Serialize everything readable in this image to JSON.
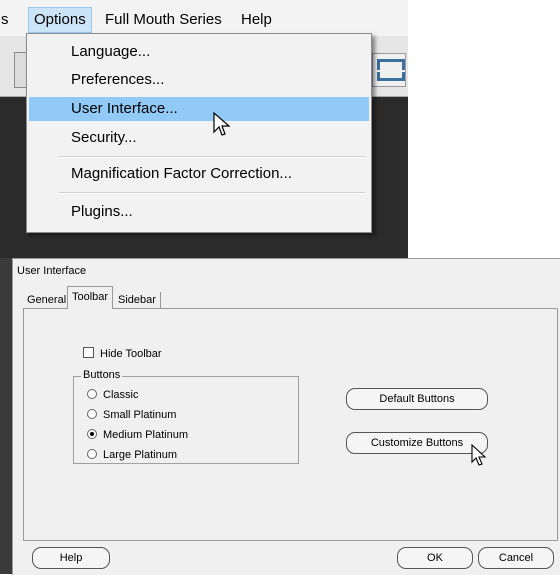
{
  "menubar": {
    "partial_left": "s",
    "options": "Options",
    "full_mouth_series": "Full Mouth Series",
    "help": "Help"
  },
  "options_menu": {
    "items": [
      {
        "label": "Language..."
      },
      {
        "label": "Preferences..."
      },
      {
        "label": "User Interface...",
        "highlighted": true
      },
      {
        "label": "Security..."
      },
      {
        "label": "Magnification Factor Correction..."
      },
      {
        "label": "Plugins..."
      }
    ]
  },
  "dialog": {
    "title": "User Interface",
    "tabs": [
      {
        "label": "General"
      },
      {
        "label": "Toolbar",
        "selected": true
      },
      {
        "label": "Sidebar"
      }
    ],
    "hide_toolbar_label": "Hide Toolbar",
    "hide_toolbar_checked": false,
    "buttons_group_label": "Buttons",
    "button_styles": [
      {
        "label": "Classic",
        "selected": false
      },
      {
        "label": "Small Platinum",
        "selected": false
      },
      {
        "label": "Medium Platinum",
        "selected": true
      },
      {
        "label": "Large Platinum",
        "selected": false
      }
    ],
    "default_buttons_label": "Default Buttons",
    "customize_buttons_label": "Customize Buttons",
    "help_label": "Help",
    "ok_label": "OK",
    "cancel_label": "Cancel"
  },
  "colors": {
    "menu_highlight": "#91c9f7",
    "menu_active": "#cce4f7",
    "dark_background": "#2b2b2b",
    "dialog_background": "#f0f0f0"
  }
}
